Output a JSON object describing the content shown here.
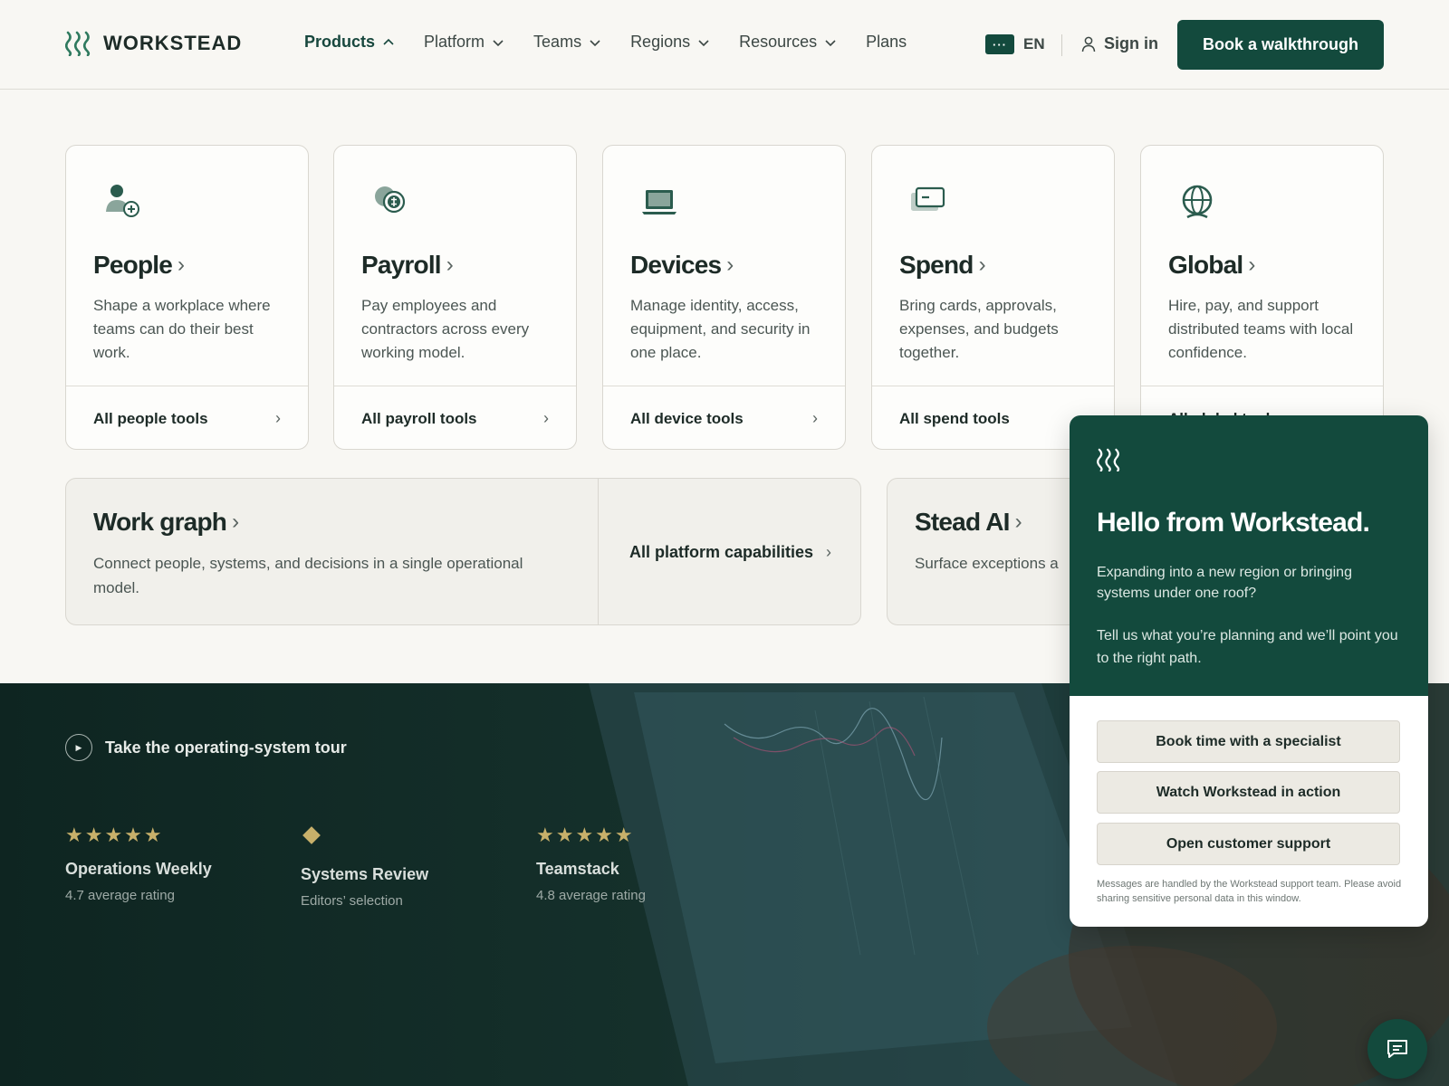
{
  "brand": {
    "name": "WORKSTEAD",
    "accent": "#134a3d",
    "gold": "#c8b06a"
  },
  "nav": {
    "items": [
      {
        "label": "Products",
        "icon": "chevron-up-icon"
      },
      {
        "label": "Platform",
        "icon": "chevron-down-icon"
      },
      {
        "label": "Teams",
        "icon": "chevron-down-icon"
      },
      {
        "label": "Regions",
        "icon": "chevron-down-icon"
      },
      {
        "label": "Resources",
        "icon": "chevron-down-icon"
      },
      {
        "label": "Plans"
      }
    ],
    "lang_badge": "···",
    "lang_code": "EN",
    "signin_label": "Sign in",
    "cta_label": "Book a walkthrough"
  },
  "products": [
    {
      "title": "People",
      "icon": "person-add-icon",
      "desc": "Shape a workplace where teams can do their best work.",
      "link": "All people tools"
    },
    {
      "title": "Payroll",
      "icon": "payroll-coins-icon",
      "desc": "Pay employees and contractors across every working model.",
      "link": "All payroll tools"
    },
    {
      "title": "Devices",
      "icon": "laptop-icon",
      "desc": "Manage identity, access, equipment, and security in one place.",
      "link": "All device tools"
    },
    {
      "title": "Spend",
      "icon": "card-icon",
      "desc": "Bring cards, approvals, expenses, and budgets together.",
      "link": "All spend tools"
    },
    {
      "title": "Global",
      "icon": "globe-icon",
      "desc": "Hire, pay, and support distributed teams with local confidence.",
      "link": "All global tools"
    }
  ],
  "platform": {
    "workgraph_title": "Work graph",
    "workgraph_desc": "Connect people, systems, and decisions in a single operational model.",
    "capabilities_label": "All platform capabilities",
    "ai_title": "Stead AI",
    "ai_desc": "Surface exceptions a"
  },
  "hero": {
    "tour_label": "Take the operating-system tour",
    "ratings": [
      {
        "kind": "stars",
        "stars": "★★★★★",
        "name": "Operations Weekly",
        "sub": "4.7 average rating"
      },
      {
        "kind": "diamond",
        "stars": "",
        "name": "Systems Review",
        "sub": "Editors’ selection"
      },
      {
        "kind": "stars",
        "stars": "★★★★★",
        "name": "Teamstack",
        "sub": "4.8 average rating"
      }
    ]
  },
  "chat": {
    "title": "Hello from Workstead.",
    "p1": "Expanding into a new region or bringing systems under one roof?",
    "p2": "Tell us what you’re planning and we’ll point you to the right path.",
    "buttons": [
      "Book time with a specialist",
      "Watch Workstead in action",
      "Open customer support"
    ],
    "note": "Messages are handled by the Workstead support team. Please avoid sharing sensitive personal data in this window."
  }
}
